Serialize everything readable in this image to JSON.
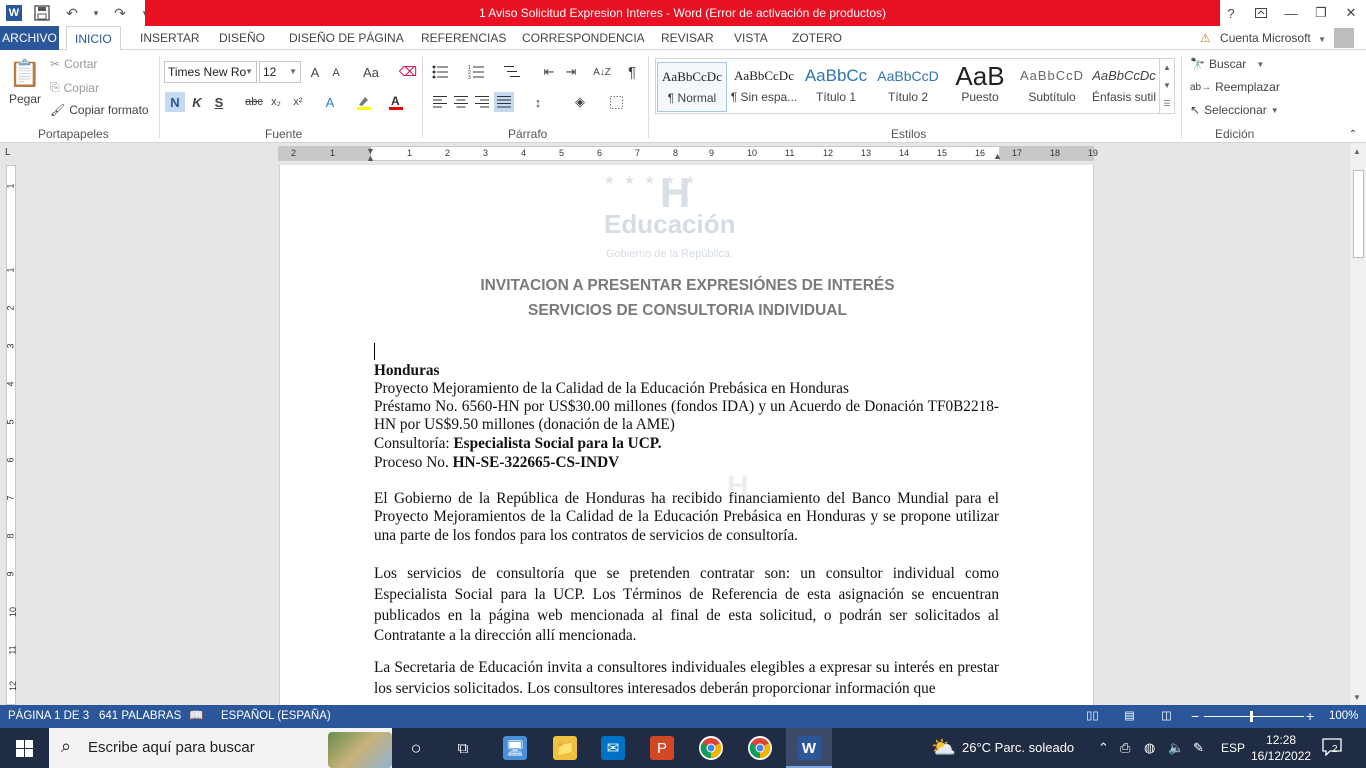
{
  "window": {
    "title": "1 Aviso Solicitud Expresion Interes -  Word (Error de activación de productos)",
    "help": "?",
    "minimize": "—",
    "restore": "❐",
    "close": "✕"
  },
  "qat": {
    "undo": "↶",
    "redo": "↷",
    "save": "💾",
    "customize": "▾"
  },
  "ribbon_tabs": [
    "ARCHIVO",
    "INICIO",
    "INSERTAR",
    "DISEÑO",
    "DISEÑO DE PÁGINA",
    "REFERENCIAS",
    "CORRESPONDENCIA",
    "REVISAR",
    "VISTA",
    "ZOTERO"
  ],
  "account": {
    "label": "Cuenta Microsoft",
    "warning_icon": "⚠"
  },
  "clipboard": {
    "paste": "Pegar",
    "cut": "Cortar",
    "copy": "Copiar",
    "format_painter": "Copiar formato",
    "group": "Portapapeles"
  },
  "font": {
    "name": "Times New Ro",
    "size": "12",
    "bold": "N",
    "italic": "K",
    "underline": "S",
    "strike": "abc",
    "sub": "x₂",
    "sup": "x²",
    "grow": "A",
    "case": "Aa",
    "color_letter": "A",
    "group": "Fuente"
  },
  "paragraph": {
    "group": "Párrafo",
    "sort": "A↓Z",
    "pilcrow": "¶"
  },
  "styles": {
    "group": "Estilos",
    "items": [
      {
        "preview": "AaBbCcDc",
        "name": "¶ Normal"
      },
      {
        "preview": "AaBbCcDc",
        "name": "¶ Sin espa..."
      },
      {
        "preview": "AaBbCc",
        "name": "Título 1"
      },
      {
        "preview": "AaBbCcD",
        "name": "Título 2"
      },
      {
        "preview": "AaB",
        "name": "Puesto"
      },
      {
        "preview": "AaBbCcD",
        "name": "Subtítulo"
      },
      {
        "preview": "AaBbCcDc",
        "name": "Énfasis sutil"
      }
    ]
  },
  "editing": {
    "find": "Buscar",
    "replace": "Reemplazar",
    "select": "Seleccionar",
    "group": "Edición"
  },
  "ruler": {
    "corner": "L",
    "h_ticks": [
      "2",
      "1",
      "1",
      "2",
      "3",
      "4",
      "5",
      "6",
      "7",
      "8",
      "9",
      "10",
      "11",
      "12",
      "13",
      "14",
      "15",
      "16",
      "17",
      "18",
      "19"
    ],
    "v_ticks": [
      "1",
      "1",
      "2",
      "3",
      "4",
      "5",
      "6",
      "7",
      "8",
      "9",
      "10",
      "11",
      "12"
    ]
  },
  "document": {
    "logo": {
      "stars": "★ ★ ★ ★ ★",
      "h": "H",
      "name": "Educación",
      "sub": "Gobierno de la República"
    },
    "heading1": "INVITACION A PRESENTAR EXPRESIÓNES DE INTERÉS",
    "heading2": "SERVICIOS DE CONSULTORIA INDIVIDUAL",
    "country": "Honduras",
    "project": "Proyecto Mejoramiento de la Calidad de la Educación Prebásica en Honduras",
    "loan": "Préstamo No. 6560-HN por US$30.00 millones (fondos IDA) y un Acuerdo de Donación TF0B2218-HN por US$9.50 millones (donación de la AME)",
    "consultancy_label": "Consultoría: ",
    "consultancy_value": "Especialista Social para la UCP.",
    "process_label": "Proceso No.  ",
    "process_value": "HN-SE-322665-CS-INDV",
    "p1": "El Gobierno de la República de Honduras ha recibido financiamiento del Banco Mundial para el Proyecto Mejoramientos de la Calidad de la Educación Prebásica en Honduras y se propone utilizar una parte de los fondos para los contratos de servicios de consultoría.",
    "p2": "Los servicios de consultoría que se pretenden contratar son: un consultor individual como Especialista Social para la UCP. Los Términos de Referencia de esta asignación se encuentran publicados en la página web mencionada al final de esta solicitud, o podrán ser solicitados al Contratante a la dirección allí mencionada.",
    "p3": "La Secretaria de Educación  invita a consultores individuales elegibles a expresar su interés en prestar los servicios solicitados. Los consultores interesados deberán proporcionar información que"
  },
  "status": {
    "page": "PÁGINA 1 DE 3",
    "words": "641 PALABRAS",
    "language": "ESPAÑOL (ESPAÑA)",
    "zoom": "100%",
    "zoom_minus": "−",
    "zoom_plus": "+"
  },
  "taskbar": {
    "search_placeholder": "Escribe aquí para buscar",
    "weather": "26°C  Parc. soleado",
    "lang": "ESP",
    "time": "12:28",
    "date": "16/12/2022",
    "notifications": "2"
  },
  "colors": {
    "word_blue": "#2b579a",
    "title_red": "#e81123",
    "taskbar": "#202c43"
  }
}
